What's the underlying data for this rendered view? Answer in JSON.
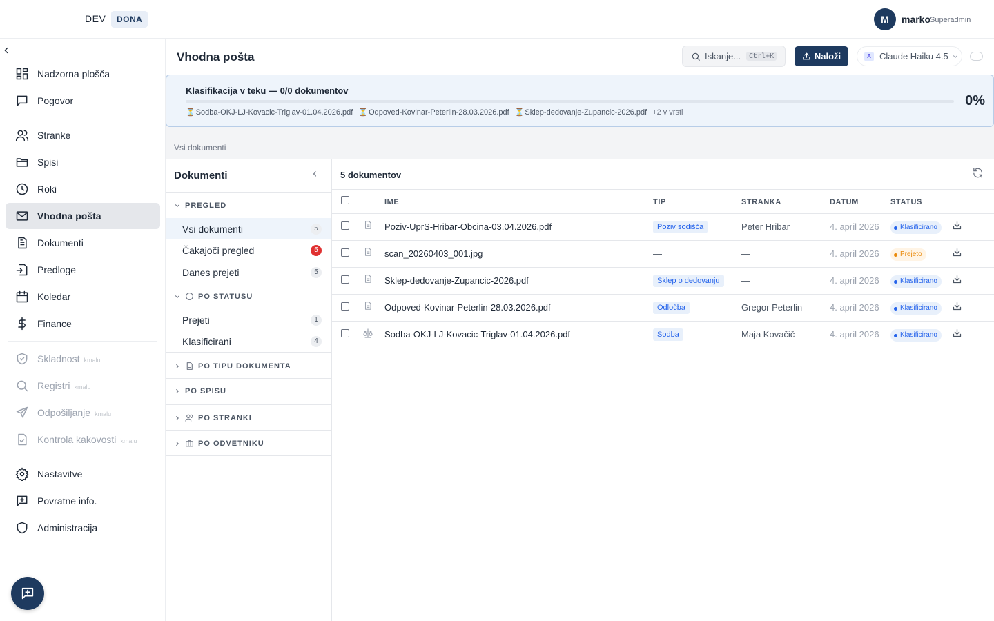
{
  "topbar": {
    "env_label": "DEV",
    "env_badge": "DONA",
    "user_initial": "M",
    "user_name": "marko",
    "user_role": "Superadmin"
  },
  "sidebar": {
    "items": [
      {
        "label": "Nadzorna plošča",
        "icon": "dashboard-icon"
      },
      {
        "label": "Pogovor",
        "icon": "chat-icon"
      },
      {
        "label": "Stranke",
        "icon": "users-icon"
      },
      {
        "label": "Spisi",
        "icon": "folder-icon"
      },
      {
        "label": "Roki",
        "icon": "clock-icon"
      },
      {
        "label": "Vhodna pošta",
        "icon": "mail-icon",
        "active": true
      },
      {
        "label": "Dokumenti",
        "icon": "document-icon"
      },
      {
        "label": "Predloge",
        "icon": "template-icon"
      },
      {
        "label": "Koledar",
        "icon": "calendar-icon"
      },
      {
        "label": "Finance",
        "icon": "dollar-icon"
      },
      {
        "label": "Skladnost",
        "icon": "shield-check-icon",
        "soon": "kmalu"
      },
      {
        "label": "Registri",
        "icon": "search-icon",
        "soon": "kmalu"
      },
      {
        "label": "Odpošiljanje",
        "icon": "send-icon",
        "soon": "kmalu"
      },
      {
        "label": "Kontrola kakovosti",
        "icon": "file-check-icon",
        "soon": "kmalu"
      },
      {
        "label": "Nastavitve",
        "icon": "gear-icon"
      },
      {
        "label": "Povratne info.",
        "icon": "feedback-icon"
      },
      {
        "label": "Administracija",
        "icon": "shield-icon"
      }
    ]
  },
  "header": {
    "title": "Vhodna pošta",
    "search_label": "Iskanje...",
    "search_shortcut": "Ctrl+K",
    "upload_label": "Naloži",
    "model_badge": "A",
    "model_name": "Claude Haiku 4.5"
  },
  "banner": {
    "title": "Klasifikacija v teku — 0/0 dokumentov",
    "percent": "0%",
    "progress": 0,
    "files": [
      "Sodba-OKJ-LJ-Kovacic-Triglav-01.04.2026.pdf",
      "Odpoved-Kovinar-Peterlin-28.03.2026.pdf",
      "Sklep-dedovanje-Zupancic-2026.pdf"
    ],
    "more": "+2 v vrsti"
  },
  "breadcrumb": "Vsi dokumenti",
  "filters": {
    "title": "Dokumenti",
    "pregled": {
      "label": "PREGLED",
      "items": [
        {
          "label": "Vsi dokumenti",
          "count": "5"
        },
        {
          "label": "Čakajoči pregled",
          "count": "5"
        },
        {
          "label": "Danes prejeti",
          "count": "5"
        }
      ]
    },
    "po_statusu": {
      "label": "PO STATUSU",
      "items": [
        {
          "label": "Prejeti",
          "count": "1"
        },
        {
          "label": "Klasificirani",
          "count": "4"
        }
      ]
    },
    "po_tipu": "PO TIPU DOKUMENTA",
    "po_spisu": "PO SPISU",
    "po_stranki": "PO STRANKI",
    "po_odvetniku": "PO ODVETNIKU"
  },
  "table": {
    "count_label": "5 dokumentov",
    "columns": {
      "name": "IME",
      "type": "TIP",
      "client": "STRANKA",
      "date": "DATUM",
      "status": "STATUS"
    },
    "rows": [
      {
        "name": "Poziv-UprS-Hribar-Obcina-03.04.2026.pdf",
        "icon": "document-icon",
        "type": "Poziv sodišča",
        "client": "Peter Hribar",
        "date": "4. april 2026",
        "status": "Klasificirano",
        "status_kind": "klas"
      },
      {
        "name": "scan_20260403_001.jpg",
        "icon": "document-icon",
        "type": "—",
        "client": "—",
        "date": "4. april 2026",
        "status": "Prejeto",
        "status_kind": "prej"
      },
      {
        "name": "Sklep-dedovanje-Zupancic-2026.pdf",
        "icon": "document-icon",
        "type": "Sklep o dedovanju",
        "client": "—",
        "date": "4. april 2026",
        "status": "Klasificirano",
        "status_kind": "klas"
      },
      {
        "name": "Odpoved-Kovinar-Peterlin-28.03.2026.pdf",
        "icon": "document-icon",
        "type": "Odločba",
        "client": "Gregor Peterlin",
        "date": "4. april 2026",
        "status": "Klasificirano",
        "status_kind": "klas"
      },
      {
        "name": "Sodba-OKJ-LJ-Kovacic-Triglav-01.04.2026.pdf",
        "icon": "scales-icon",
        "type": "Sodba",
        "client": "Maja Kovačič",
        "date": "4. april 2026",
        "status": "Klasificirano",
        "status_kind": "klas"
      }
    ]
  },
  "colors": {
    "primary": "#1e3a5f",
    "tag_bg": "#e8f0fb",
    "tag_text": "#2563eb",
    "warning": "#ea8a0b",
    "danger": "#e03131"
  }
}
